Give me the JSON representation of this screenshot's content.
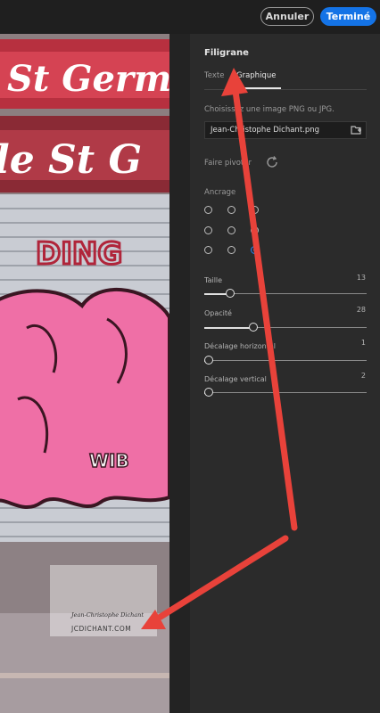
{
  "toolbar": {
    "cancel_label": "Annuler",
    "done_label": "Terminé"
  },
  "panel": {
    "title": "Filigrane",
    "tabs": [
      {
        "label": "Texte"
      },
      {
        "label": "Graphique"
      }
    ],
    "active_tab": "Graphique",
    "choose_label": "Choisissez une image PNG ou JPG.",
    "file_value": "Jean-Christophe Dichant.png",
    "rotate_label": "Faire pivoter",
    "anchor_label": "Ancrage",
    "anchor_selected": "bottom-right",
    "sliders": [
      {
        "label": "Taille",
        "value": "13",
        "fraction": 0.14
      },
      {
        "label": "Opacité",
        "value": "28",
        "fraction": 0.29
      },
      {
        "label": "Décalage horizontal",
        "value": "1",
        "fraction": 0.0
      },
      {
        "label": "Décalage vertical",
        "value": "2",
        "fraction": 0.0
      }
    ]
  },
  "preview": {
    "signage": [
      "St Germ",
      "le St G"
    ],
    "graffiti_tag": "DING",
    "graffiti_word": "WIB",
    "watermark_signature": "Jean-Christophe Dichant",
    "watermark_url": "JCDICHANT.COM"
  },
  "colors": {
    "accent": "#1473e6",
    "annotation_arrow": "#e8423a",
    "panel_bg": "#2b2b2b"
  }
}
